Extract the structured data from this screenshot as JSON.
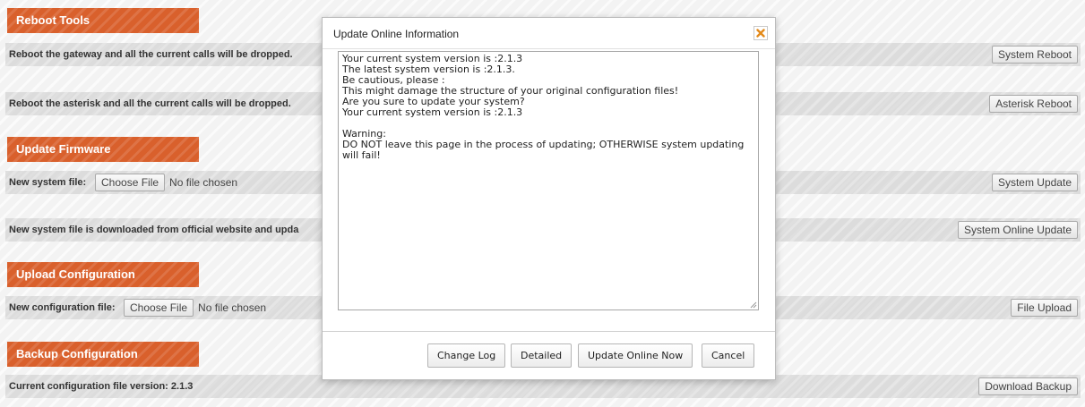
{
  "sections": {
    "reboot": {
      "title": "Reboot Tools",
      "rows": [
        {
          "label": "Reboot the gateway and all the current calls will be dropped.",
          "button": "System Reboot"
        },
        {
          "label": "Reboot the asterisk and all the current calls will be dropped.",
          "button": "Asterisk Reboot"
        }
      ]
    },
    "firmware": {
      "title": "Update Firmware",
      "file_row": {
        "label": "New system file:",
        "choose": "Choose File",
        "status": "No file chosen",
        "button": "System Update"
      },
      "online_row": {
        "label": "New system file is downloaded from official website and upda",
        "button": "System Online Update"
      }
    },
    "upload": {
      "title": "Upload Configuration",
      "file_row": {
        "label": "New configuration file:",
        "choose": "Choose File",
        "status": "No file chosen",
        "button": "File Upload"
      }
    },
    "backup": {
      "title": "Backup Configuration",
      "row": {
        "label": "Current configuration file version: 2.1.3",
        "button": "Download Backup"
      }
    }
  },
  "modal": {
    "title": "Update Online Information",
    "close_icon": "close-icon",
    "accent": "#e38a1a",
    "lines": [
      "Your current system version is :2.1.3",
      "The latest system version is :2.1.3.",
      "Be cautious, please :",
      "This might damage the structure of your original configuration files!",
      "Are you sure to update your system?",
      "Your current system version is :2.1.3",
      "",
      "Warning:",
      "DO NOT leave this page in the process of updating; OTHERWISE system updating",
      "will fail!"
    ],
    "buttons": {
      "change_log": "Change Log",
      "detailed": "Detailed",
      "update_now": "Update Online Now",
      "cancel": "Cancel"
    }
  },
  "colors": {
    "section_header": "#d9602c",
    "page_background": "#f3f3f3"
  }
}
